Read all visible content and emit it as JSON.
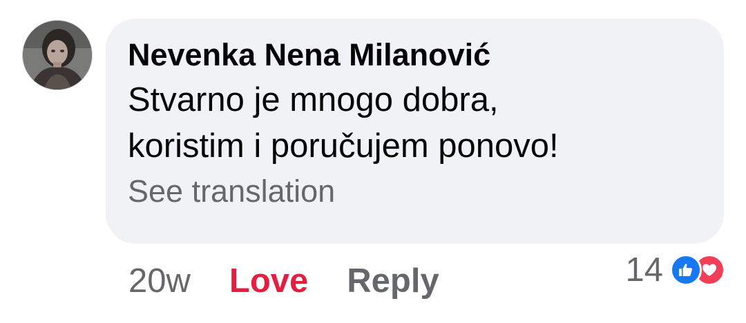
{
  "comment": {
    "author": "Nevenka Nena Milanović",
    "text_lines": [
      "Stvarno je mnogo dobra,",
      "koristim i poručujem ponovo!"
    ],
    "see_translation": "See translation",
    "timestamp": "20w",
    "love_label": "Love",
    "reply_label": "Reply",
    "reaction_count": "14",
    "reaction_icons": [
      "like-icon",
      "heart-icon"
    ]
  },
  "colors": {
    "bubble_background": "#f0f2f5",
    "love_red": "#e41e3f",
    "secondary_text": "#65676b",
    "like_blue": "#1877f2",
    "heart_pink": "#f33e58"
  }
}
